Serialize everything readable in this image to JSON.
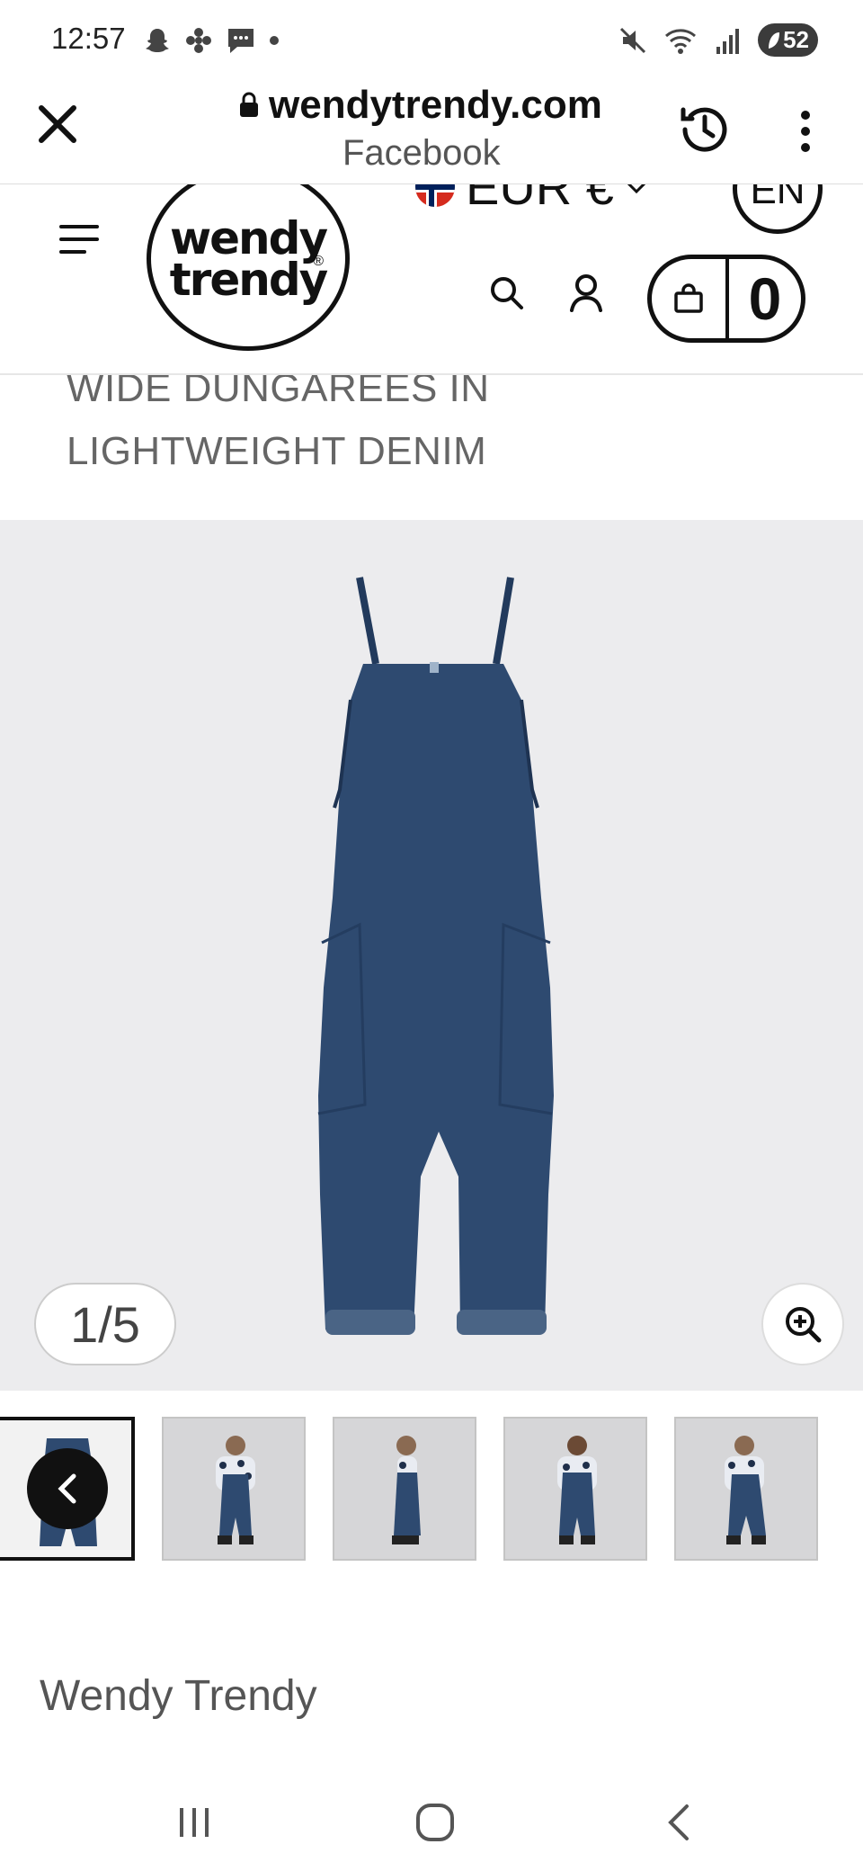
{
  "status_bar": {
    "time": "12:57",
    "battery": "52"
  },
  "browser": {
    "domain": "wendytrendy.com",
    "referrer": "Facebook"
  },
  "header": {
    "logo_line1": "wendy",
    "logo_line2": "trendy",
    "logo_reg": "®",
    "currency": "EUR €",
    "language": "EN",
    "cart_count": "0"
  },
  "product": {
    "title_line1": "WIDE DUNGAREES IN",
    "title_line2": "LIGHTWEIGHT DENIM",
    "image_counter": "1/5",
    "thumbnail_count": 5,
    "brand": "Wendy Trendy"
  },
  "colors": {
    "denim": "#2e4a70",
    "gallery_bg": "#ececee",
    "text_grey": "#666666"
  }
}
